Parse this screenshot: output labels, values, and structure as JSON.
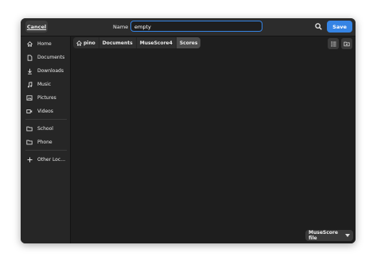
{
  "header": {
    "cancel_label": "Cancel",
    "name_label": "Name",
    "name_value": "empty",
    "save_label": "Save"
  },
  "sidebar": {
    "items": [
      {
        "label": "Home",
        "icon": "home-icon"
      },
      {
        "label": "Documents",
        "icon": "document-icon"
      },
      {
        "label": "Downloads",
        "icon": "download-icon"
      },
      {
        "label": "Music",
        "icon": "music-icon"
      },
      {
        "label": "Pictures",
        "icon": "picture-icon"
      },
      {
        "label": "Videos",
        "icon": "video-icon"
      },
      {
        "label": "School",
        "icon": "folder-icon"
      },
      {
        "label": "Phone",
        "icon": "folder-icon"
      },
      {
        "label": "Other Loc…",
        "icon": "plus-icon"
      }
    ]
  },
  "pathbar": {
    "crumbs": [
      "pino",
      "Documents",
      "MuseScore4",
      "Scores"
    ]
  },
  "footer": {
    "filter_label": "MuseScore file"
  },
  "colors": {
    "accent": "#3584e4",
    "background": "#1e1e1e",
    "sidebar": "#262626"
  }
}
